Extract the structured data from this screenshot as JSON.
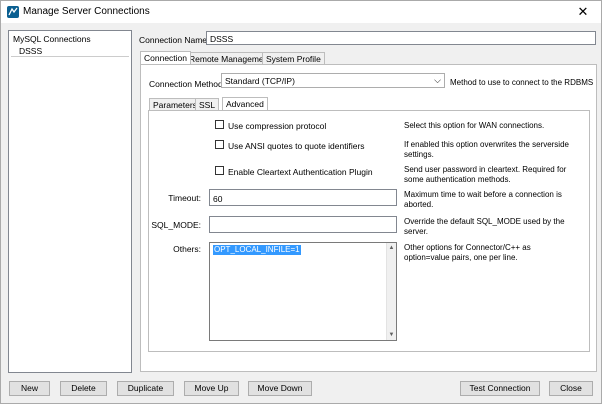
{
  "window": {
    "title": "Manage Server Connections",
    "close": "✕"
  },
  "tree": {
    "root": "MySQL Connections",
    "items": [
      "DSSS"
    ]
  },
  "connection_name": {
    "label": "Connection Name:",
    "value": "DSSS"
  },
  "main_tabs": [
    "Connection",
    "Remote Management",
    "System Profile"
  ],
  "connection_method": {
    "label": "Connection Method:",
    "value": "Standard (TCP/IP)",
    "hint": "Method to use to connect to the RDBMS"
  },
  "sub_tabs": [
    "Parameters",
    "SSL",
    "Advanced"
  ],
  "advanced": {
    "checkboxes": [
      {
        "label": "Use compression protocol",
        "desc": "Select this option for WAN connections."
      },
      {
        "label": "Use ANSI quotes to quote identifiers",
        "desc": "If enabled this option overwrites the serverside settings."
      },
      {
        "label": "Enable Cleartext Authentication Plugin",
        "desc": "Send user password in cleartext. Required for some authentication methods."
      }
    ],
    "timeout": {
      "label": "Timeout:",
      "value": "60",
      "desc": "Maximum time to wait before a connection is aborted."
    },
    "sql_mode": {
      "label": "SQL_MODE:",
      "value": "",
      "desc": "Override the default SQL_MODE used by the server."
    },
    "others": {
      "label": "Others:",
      "value": "OPT_LOCAL_INFILE=1",
      "desc": "Other options for Connector/C++ as option=value pairs, one per line."
    }
  },
  "buttons": {
    "new": "New",
    "delete": "Delete",
    "duplicate": "Duplicate",
    "move_up": "Move Up",
    "move_down": "Move Down",
    "test_connection": "Test Connection",
    "close": "Close"
  }
}
